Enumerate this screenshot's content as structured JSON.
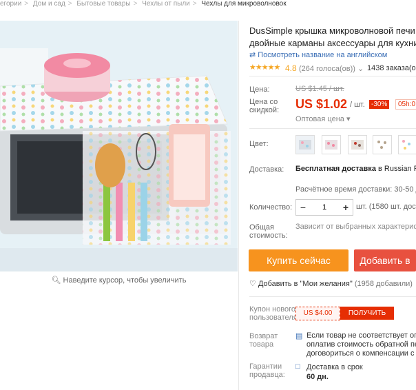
{
  "breadcrumb": {
    "items": [
      "егории",
      "Дом и сад",
      "Бытовые товары",
      "Чехлы от пыли",
      "Чехлы для микроволновок"
    ],
    "separator": ">"
  },
  "gallery": {
    "zoom_hint": "Наведите курсор, чтобы увеличить"
  },
  "product": {
    "title_line1": "DusSimple крышка микроволновой печи к",
    "title_line2": "двойные карманы аксессуары для кухни п",
    "translate_link": "Посмотреть название на английском",
    "stars": "★★★★★",
    "rating": "4.8",
    "votes": "(264 голоса(ов))",
    "orders": "1438 заказа(ов"
  },
  "price": {
    "label": "Цена:",
    "old": "US $1.45 / шт.",
    "discount_label_1": "Цена со",
    "discount_label_2": "скидкой:",
    "current": "US $1.02",
    "unit": "/ шт.",
    "discount": "-30%",
    "timer": "05h:0",
    "wholesale": "Оптовая цена"
  },
  "color": {
    "label": "Цвет:"
  },
  "delivery": {
    "label": "Доставка:",
    "free": "Бесплатная доставка",
    "to": "в Russian Fede",
    "estimate": "Расчётное время доставки: 30-50 дн"
  },
  "quantity": {
    "label": "Количество:",
    "value": "1",
    "info": "шт. (1580 шт. досту"
  },
  "total": {
    "label_1": "Общая",
    "label_2": "стоимость:",
    "text": "Зависит от выбранных характеристи"
  },
  "actions": {
    "buy": "Купить сейчас",
    "cart": "Добавить в"
  },
  "wishlist": {
    "text": "Добавить в \"Мои желания\"",
    "count": "(1958 добавили)"
  },
  "coupon": {
    "label_1": "Купон нового",
    "label_2": "пользователя",
    "value": "US $4.00",
    "get": "ПОЛУЧИТЬ"
  },
  "returns": {
    "label_1": "Возврат",
    "label_2": "товара",
    "line1": "Если товар не соответствует описа",
    "line2": "оплатив стоимость обратной пере",
    "line3": "договориться о компенсации с пр"
  },
  "guarantee": {
    "label_1": "Гарантии",
    "label_2": "продавца:",
    "line1": "Доставка в срок",
    "line2": "60 дн."
  },
  "colors": {
    "accent": "#e62e04",
    "buy": "#f7931e",
    "cart": "#e8513f",
    "link": "#3b6fb6",
    "star": "#f5a623"
  }
}
